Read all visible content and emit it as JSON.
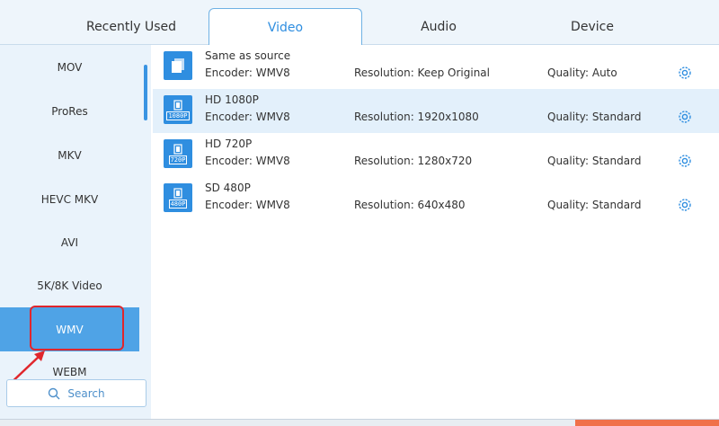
{
  "tabs": [
    {
      "label": "Recently Used",
      "active": false
    },
    {
      "label": "Video",
      "active": true
    },
    {
      "label": "Audio",
      "active": false
    },
    {
      "label": "Device",
      "active": false
    }
  ],
  "sidebar": {
    "items": [
      {
        "label": "MOV"
      },
      {
        "label": "ProRes"
      },
      {
        "label": "MKV"
      },
      {
        "label": "HEVC MKV"
      },
      {
        "label": "AVI"
      },
      {
        "label": "5K/8K Video"
      },
      {
        "label": "WMV",
        "selected": true
      },
      {
        "label": "WEBM"
      }
    ],
    "search_label": "Search"
  },
  "presets": [
    {
      "title": "Same as source",
      "encoder": "Encoder: WMV8",
      "resolution": "Resolution: Keep Original",
      "quality": "Quality: Auto",
      "badge": "",
      "icon": "same-as-source-icon"
    },
    {
      "title": "HD 1080P",
      "encoder": "Encoder: WMV8",
      "resolution": "Resolution: 1920x1080",
      "quality": "Quality: Standard",
      "badge": "1080P",
      "icon": "film-1080p-icon",
      "selected": true
    },
    {
      "title": "HD 720P",
      "encoder": "Encoder: WMV8",
      "resolution": "Resolution: 1280x720",
      "quality": "Quality: Standard",
      "badge": "720P",
      "icon": "film-720p-icon"
    },
    {
      "title": "SD 480P",
      "encoder": "Encoder: WMV8",
      "resolution": "Resolution: 640x480",
      "quality": "Quality: Standard",
      "badge": "480P",
      "icon": "film-480p-icon"
    }
  ],
  "colors": {
    "accent": "#2f8ee0",
    "selected_sidebar": "#4fa3e6",
    "annotation": "#e0262c"
  }
}
